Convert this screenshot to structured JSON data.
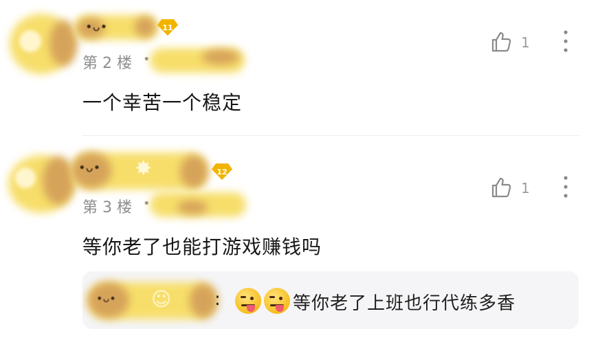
{
  "comments": [
    {
      "floor_label": "第 2 楼",
      "separator": "•",
      "level": "11",
      "content": "一个幸苦一个稳定",
      "like_count": "1"
    },
    {
      "floor_label": "第 3 楼",
      "separator": "•",
      "level": "12",
      "content": "等你老了也能打游戏赚钱吗",
      "like_count": "1",
      "reply": {
        "colon": ":",
        "text": "等你老了上班也行代练多香"
      }
    }
  ],
  "icons": [
    "thumbs-up-icon",
    "more-vertical-icon",
    "tongue-out-emoji"
  ]
}
